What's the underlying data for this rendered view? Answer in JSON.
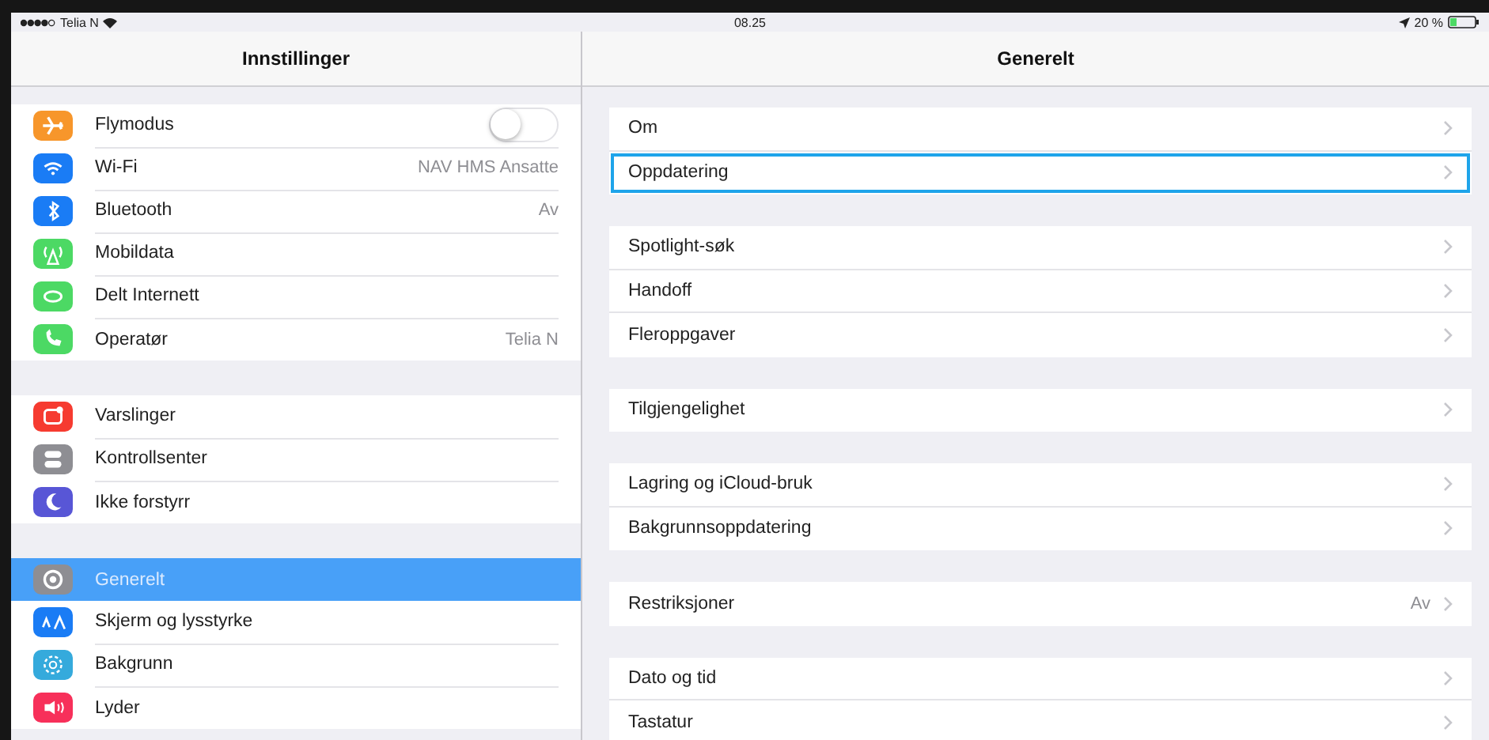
{
  "status_bar": {
    "carrier": "Telia N",
    "time": "08.25",
    "battery": "20 %"
  },
  "sidebar": {
    "title": "Innstillinger",
    "groups": [
      [
        {
          "label": "Flymodus",
          "kind": "toggle",
          "on": false,
          "color": "#f7962b",
          "selected": false
        },
        {
          "label": "Wi-Fi",
          "kind": "value",
          "value": "NAV HMS Ansatte",
          "color": "#1a7cf5",
          "selected": false
        },
        {
          "label": "Bluetooth",
          "kind": "value",
          "value": "Av",
          "color": "#1a7cf5",
          "selected": false
        },
        {
          "label": "Mobildata",
          "kind": "plain",
          "color": "#4cd964",
          "selected": false
        },
        {
          "label": "Delt Internett",
          "kind": "plain",
          "color": "#4cd964",
          "selected": false
        },
        {
          "label": "Operatør",
          "kind": "value",
          "value": "Telia N",
          "color": "#4cd964",
          "selected": false
        }
      ],
      [
        {
          "label": "Varslinger",
          "kind": "plain",
          "color": "#f63b30",
          "selected": false
        },
        {
          "label": "Kontrollsenter",
          "kind": "plain",
          "color": "#8e8e93",
          "selected": false
        },
        {
          "label": "Ikke forstyrr",
          "kind": "plain",
          "color": "#5856d6",
          "selected": false
        }
      ],
      [
        {
          "label": "Generelt",
          "kind": "plain",
          "color": "#8e8e93",
          "selected": true
        },
        {
          "label": "Skjerm og lysstyrke",
          "kind": "plain",
          "color": "#1a7cf5",
          "selected": false
        },
        {
          "label": "Bakgrunn",
          "kind": "plain",
          "color": "#35aadc",
          "selected": false
        },
        {
          "label": "Lyder",
          "kind": "plain",
          "color": "#f7305a",
          "selected": false
        }
      ]
    ]
  },
  "detail": {
    "title": "Generelt",
    "groups": [
      [
        {
          "label": "Om",
          "outlined": false
        },
        {
          "label": "Oppdatering",
          "outlined": true
        }
      ],
      [
        {
          "label": "Spotlight-søk",
          "outlined": false
        },
        {
          "label": "Handoff",
          "outlined": false
        },
        {
          "label": "Fleroppgaver",
          "outlined": false
        }
      ],
      [
        {
          "label": "Tilgjengelighet",
          "outlined": false
        }
      ],
      [
        {
          "label": "Lagring og iCloud-bruk",
          "outlined": false
        },
        {
          "label": "Bakgrunnsoppdatering",
          "outlined": false
        }
      ],
      [
        {
          "label": "Restriksjoner",
          "value": "Av",
          "outlined": false
        }
      ],
      [
        {
          "label": "Dato og tid",
          "outlined": false
        },
        {
          "label": "Tastatur",
          "outlined": false
        }
      ]
    ]
  }
}
